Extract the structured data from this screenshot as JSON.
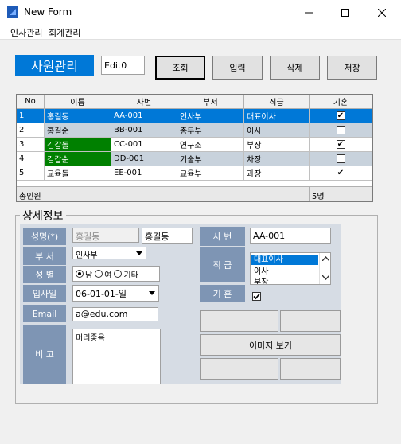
{
  "window": {
    "title": "New Form",
    "minimize": "—",
    "maximize": "☐",
    "close": "✕"
  },
  "menu": {
    "items": [
      "인사관리",
      "회계관리"
    ]
  },
  "header": {
    "title": "사원관리",
    "edit_value": "Edit0",
    "buttons": {
      "search": "조회",
      "insert": "입력",
      "delete": "삭제",
      "save": "저장"
    }
  },
  "grid": {
    "columns": [
      "No",
      "이름",
      "사번",
      "부서",
      "직급",
      "기혼"
    ],
    "rows": [
      {
        "no": "1",
        "name": "홍길동",
        "id": "AA-001",
        "dept": "인사부",
        "rank": "대표이사",
        "married": true,
        "selected": true
      },
      {
        "no": "2",
        "name": "홍길순",
        "id": "BB-001",
        "dept": "총무부",
        "rank": "이사",
        "married": false
      },
      {
        "no": "3",
        "name": "김갑돌",
        "id": "CC-001",
        "dept": "연구소",
        "rank": "부장",
        "married": true,
        "highlight": true
      },
      {
        "no": "4",
        "name": "김갑순",
        "id": "DD-001",
        "dept": "기술부",
        "rank": "차장",
        "married": false,
        "highlight": true
      },
      {
        "no": "5",
        "name": "교육돌",
        "id": "EE-001",
        "dept": "교육부",
        "rank": "과장",
        "married": true
      }
    ],
    "footer": {
      "label": "총인원",
      "count": "5명"
    }
  },
  "detail": {
    "title": "상세정보",
    "labels": {
      "name": "성명(*)",
      "dept": "부 서",
      "gender": "성 별",
      "hire_date": "입사일",
      "email": "Email",
      "note": "비 고",
      "emp_id": "사 번",
      "rank": "직 급",
      "married": "기 혼"
    },
    "name_readonly": "홍길동",
    "name_value": "홍길동",
    "dept_value": "인사부",
    "gender_options": [
      "남",
      "여",
      "기타"
    ],
    "gender_selected": "남",
    "hire_date": "06-01-01-일",
    "email": "a@edu.com",
    "note": "머리좋음",
    "emp_id": "AA-001",
    "rank_options": [
      "대표이사",
      "이사",
      "부장"
    ],
    "married_checked": true,
    "image_button": "이미지 보기"
  },
  "colors": {
    "accent": "#0078d7",
    "label_bg": "#7e95b4",
    "highlight_green": "#008000",
    "alt_row": "#c8d2dc"
  }
}
